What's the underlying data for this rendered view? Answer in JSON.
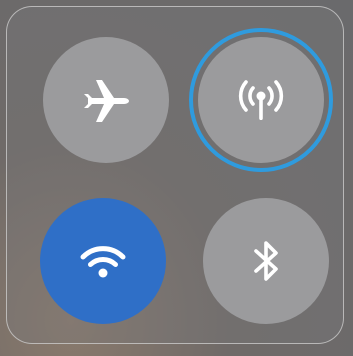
{
  "control_center": {
    "tiles": [
      {
        "name": "airplane-mode",
        "state": "off",
        "icon": "airplane-icon"
      },
      {
        "name": "cellular-data",
        "state": "off",
        "icon": "antenna-icon",
        "focused": true
      },
      {
        "name": "wifi",
        "state": "on",
        "icon": "wifi-icon"
      },
      {
        "name": "bluetooth",
        "state": "off",
        "icon": "bluetooth-icon"
      }
    ],
    "colors": {
      "tile_off": "#9b9b9d",
      "tile_on": "#2f6fc7",
      "focus_ring": "#2f9bde",
      "icon": "#ffffff"
    }
  }
}
